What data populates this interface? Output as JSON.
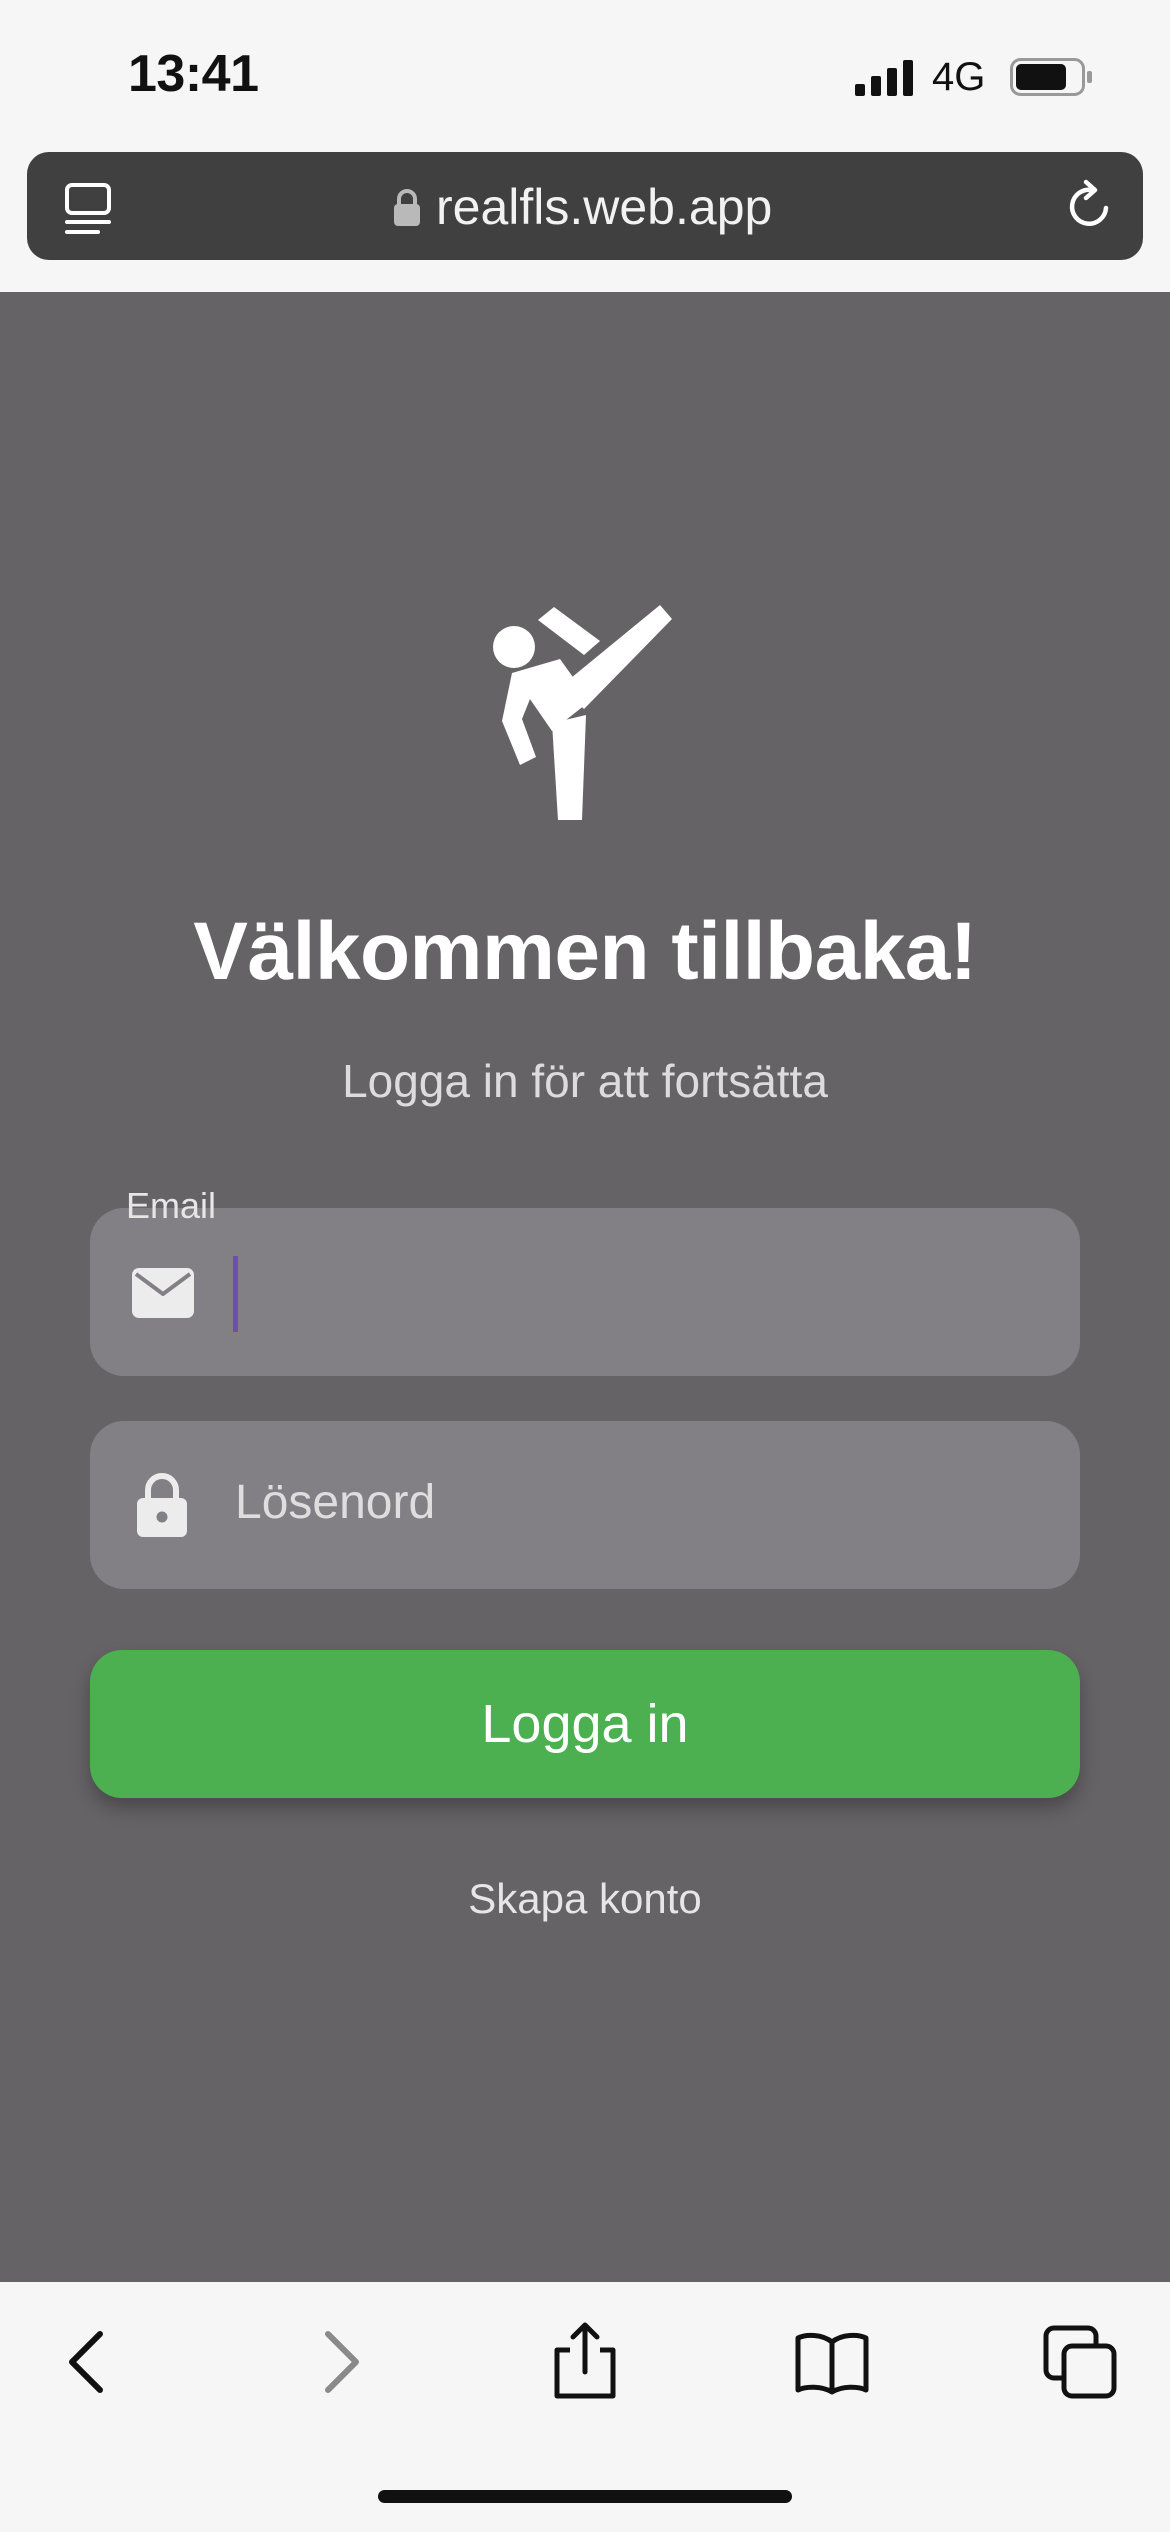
{
  "status_bar": {
    "time": "13:41",
    "network": "4G"
  },
  "browser": {
    "url": "realfls.web.app",
    "icons": [
      "reader-icon",
      "lock-icon",
      "reload-icon"
    ]
  },
  "login": {
    "title": "Välkommen tillbaka!",
    "subtitle": "Logga in för att fortsätta",
    "email_label": "Email",
    "email_value": "",
    "password_placeholder": "Lösenord",
    "login_button": "Logga in",
    "create_account_link": "Skapa konto",
    "accent_color": "#4caf50",
    "logo_icon": "martial-arts-kick-icon"
  },
  "toolbar": {
    "icons": [
      "back-icon",
      "forward-icon",
      "share-icon",
      "bookmarks-icon",
      "tabs-icon"
    ]
  }
}
